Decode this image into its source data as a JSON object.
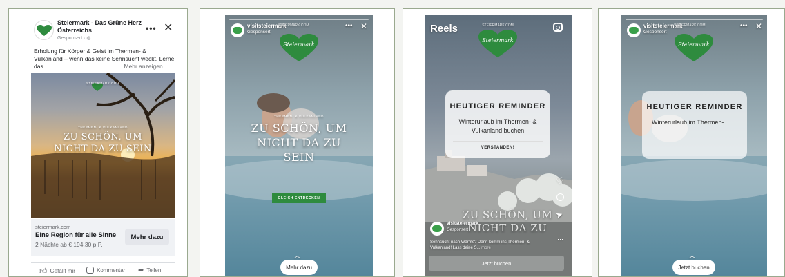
{
  "panel1": {
    "account_name": "Steiermark - Das Grüne Herz Österreichs",
    "sponsored": "Gesponsert",
    "more_icon": "ellipsis-icon",
    "close_icon": "close-icon",
    "body_text": "Erholung für Körper & Geist im Thermen- & Vulkanland – wenn das keine Sehnsucht weckt. Lerne das",
    "more_link": "... Mehr anzeigen",
    "image_brand": "STEIERMARK.COM",
    "image_region": "THERMEN- & VULKANLAND",
    "image_headline_1": "ZU SCHÖN, UM",
    "image_headline_2": "NICHT DA ZU SEIN",
    "link_domain": "steiermark.com",
    "link_title": "Eine Region für alle Sinne",
    "link_subtitle": "2 Nächte ab € 194,30 p.P.",
    "cta": "Mehr dazu",
    "actions": [
      "Gefällt mir",
      "Kommentar",
      "Teilen"
    ]
  },
  "panel2": {
    "account": "visitsteiermark",
    "brand_url": "STEIERMARK.COM",
    "sponsored": "Gesponsert",
    "region": "THERMEN- & VULKANLAND",
    "headline_1": "ZU SCHÖN, UM",
    "headline_2": "NICHT DA ZU",
    "headline_3": "SEIN",
    "inner_cta": "GLEICH ENTDECKEN",
    "cta": "Mehr dazu"
  },
  "panel3": {
    "title": "Reels",
    "brand_url": "STEIERMARK.COM",
    "reminder_title": "HEUTIGER REMINDER",
    "reminder_body": "Winterurlaub im Thermen- & Vulkanland buchen",
    "reminder_button": "VERSTANDEN!",
    "headline_1": "ZU SCHÖN, UM",
    "headline_2": "NICHT DA ZU",
    "account": "visitsteiermark",
    "sponsored": "Gesponsert",
    "caption": "Sehnsucht nach Wärme? Dann komm ins Thermen- & Vulkanland! Lass deine S...",
    "caption_more": "more",
    "cta": "Jetzt buchen"
  },
  "panel4": {
    "account": "visitsteiermark",
    "brand_url": "STEIERMARK.COM",
    "sponsored": "Gesponsert",
    "reminder_title": "HEUTIGER REMINDER",
    "reminder_body": "Winterurlaub im Thermen-",
    "cta": "Jetzt buchen"
  },
  "brand_logo_text": "Steiermark",
  "colors": {
    "brand_green": "#2e8b3e",
    "fb_blue": "#1877f2"
  }
}
